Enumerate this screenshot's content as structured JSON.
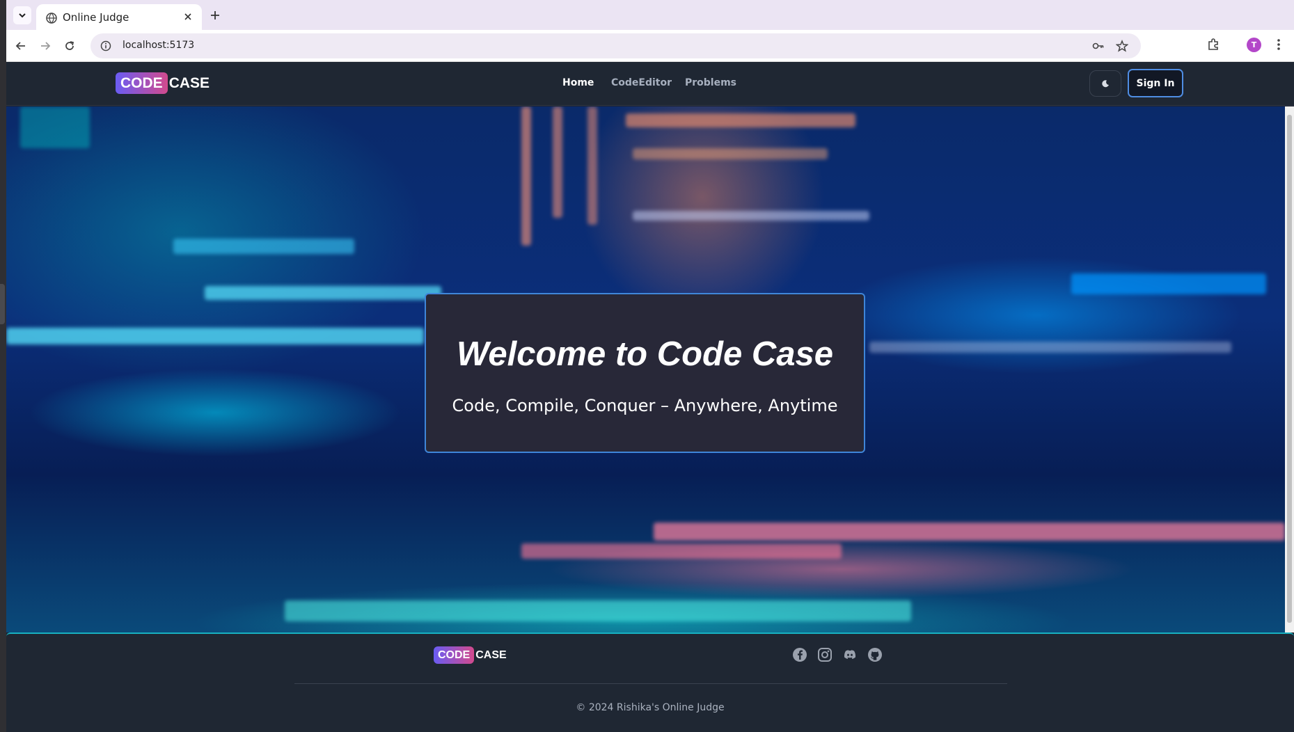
{
  "browser": {
    "tab_title": "Online Judge",
    "url": "localhost:5173",
    "profile_initial": "T"
  },
  "site": {
    "logo_code": "CODE",
    "logo_case": "CASE",
    "nav": [
      {
        "label": "Home",
        "active": true
      },
      {
        "label": "CodeEditor",
        "active": false
      },
      {
        "label": "Problems",
        "active": false
      }
    ],
    "theme_icon": "moon-icon",
    "signin_label": "Sign In"
  },
  "hero": {
    "title": "Welcome to Code Case",
    "subtitle": "Code, Compile, Conquer – Anywhere, Anytime"
  },
  "footer": {
    "logo_code": "CODE",
    "logo_case": "CASE",
    "social_icons": [
      "facebook-icon",
      "instagram-icon",
      "discord-icon",
      "github-icon"
    ],
    "copyright": "© 2024 Rishika's Online Judge"
  },
  "colors": {
    "accent_blue": "#4f8de3",
    "footer_border": "#17b1c1",
    "logo_gradient_start": "#6a5cf3",
    "logo_gradient_end": "#d24a8d"
  }
}
